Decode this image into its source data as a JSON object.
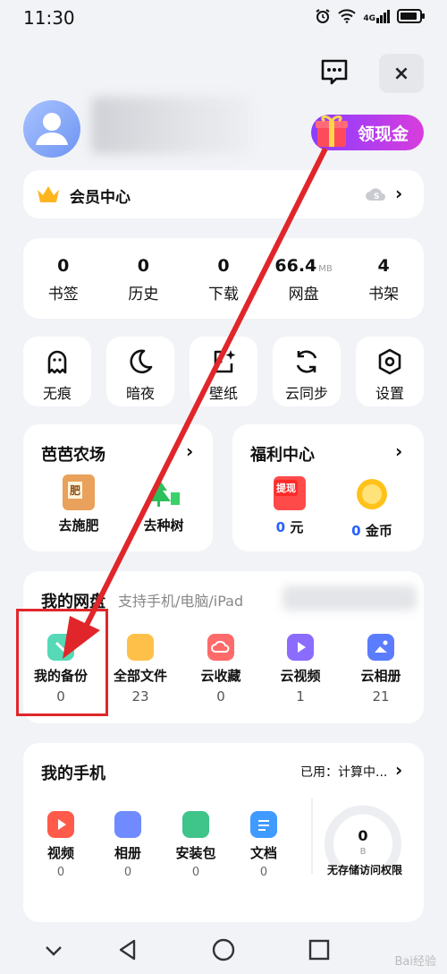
{
  "status_bar": {
    "time": "11:30",
    "signal_text": "4G"
  },
  "header": {
    "close_label": "×",
    "cash_button_label": "领现金"
  },
  "vip": {
    "label": "会员中心"
  },
  "stats": [
    {
      "num": "0",
      "unit": "",
      "label": "书签"
    },
    {
      "num": "0",
      "unit": "",
      "label": "历史"
    },
    {
      "num": "0",
      "unit": "",
      "label": "下载"
    },
    {
      "num": "66.4",
      "unit": "MB",
      "label": "网盘"
    },
    {
      "num": "4",
      "unit": "",
      "label": "书架"
    }
  ],
  "tools": [
    {
      "label": "无痕",
      "icon": "ghost-icon"
    },
    {
      "label": "暗夜",
      "icon": "moon-icon"
    },
    {
      "label": "壁纸",
      "icon": "wallpaper-icon"
    },
    {
      "label": "云同步",
      "icon": "sync-icon"
    },
    {
      "label": "设置",
      "icon": "settings-icon"
    }
  ],
  "farm": {
    "title": "芭芭农场",
    "items": [
      {
        "label": "去施肥",
        "badge": "肥"
      },
      {
        "label": "去种树"
      }
    ]
  },
  "welfare": {
    "title": "福利中心",
    "items": [
      {
        "value": "0",
        "unit": "元",
        "badge": "提现"
      },
      {
        "value": "0",
        "unit": "金币"
      }
    ]
  },
  "cloud_disk": {
    "title": "我的网盘",
    "subtitle": "支持手机/电脑/iPad",
    "items": [
      {
        "label": "我的备份",
        "count": "0",
        "color": "#4fd6b4"
      },
      {
        "label": "全部文件",
        "count": "23",
        "color": "#ffc04a"
      },
      {
        "label": "云收藏",
        "count": "0",
        "color": "#ff6a6a"
      },
      {
        "label": "云视频",
        "count": "1",
        "color": "#8b6cff"
      },
      {
        "label": "云相册",
        "count": "21",
        "color": "#5b7cff"
      }
    ]
  },
  "my_phone": {
    "title": "我的手机",
    "usage": "已用：计算中...",
    "items": [
      {
        "label": "视频",
        "count": "0",
        "color": "#ff5a4a"
      },
      {
        "label": "相册",
        "count": "0",
        "color": "#6f8bff"
      },
      {
        "label": "安装包",
        "count": "0",
        "color": "#3fc48a"
      },
      {
        "label": "文档",
        "count": "0",
        "color": "#3f9bff"
      }
    ],
    "storage_value": "0",
    "storage_unit": "B",
    "storage_note": "无存储访问权限"
  },
  "watermark": "Bai经验"
}
